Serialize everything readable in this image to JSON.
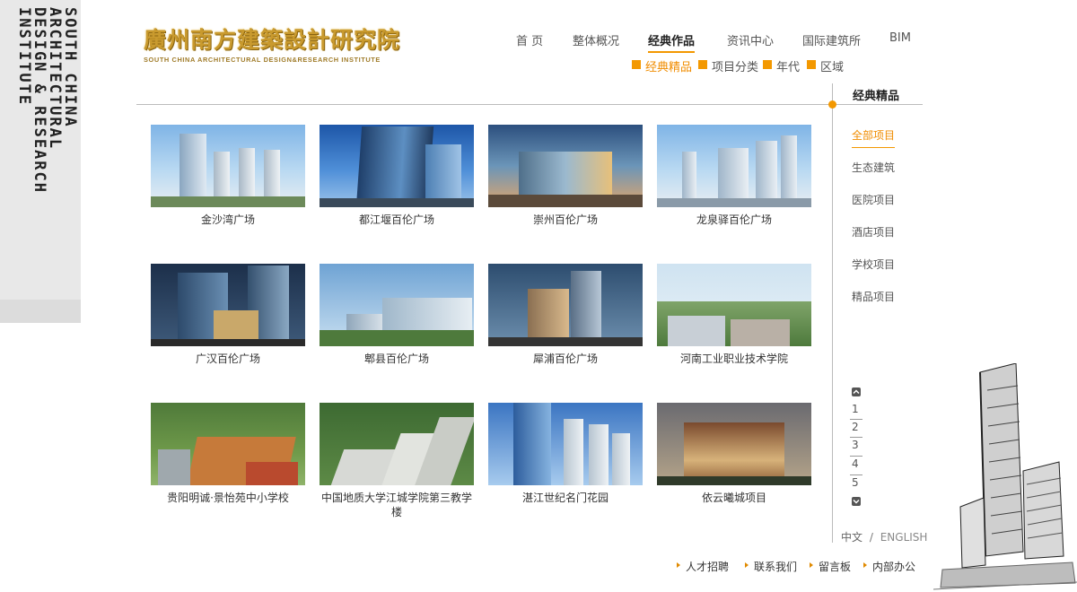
{
  "side_band": {
    "lines": [
      "SOUTH CHINA",
      "ARCHITECTURAL",
      "DESIGN & RESEARCH",
      "INSTITUTE"
    ]
  },
  "logo": {
    "cn": "廣州南方建築設計研究院",
    "en": "SOUTH CHINA ARCHITECTURAL DESIGN&RESEARCH INSTITUTE"
  },
  "nav": {
    "items": [
      "首 页",
      "整体概况",
      "经典作品",
      "资讯中心",
      "国际建筑所",
      "BIM"
    ],
    "active_index": 2
  },
  "subnav": {
    "items": [
      "经典精品",
      "项目分类",
      "年代",
      "区域"
    ],
    "active_index": 0
  },
  "right_panel": {
    "title": "经典精品",
    "categories": [
      "全部项目",
      "生态建筑",
      "医院项目",
      "酒店项目",
      "学校项目",
      "精品项目"
    ],
    "active_index": 0
  },
  "projects": [
    {
      "name": "金沙湾广场"
    },
    {
      "name": "都江堰百伦广场"
    },
    {
      "name": "崇州百伦广场"
    },
    {
      "name": "龙泉驿百伦广场"
    },
    {
      "name": "广汉百伦广场"
    },
    {
      "name": "郫县百伦广场"
    },
    {
      "name": "犀浦百伦广场"
    },
    {
      "name": "河南工业职业技术学院"
    },
    {
      "name": "贵阳明诚·景怡苑中小学校"
    },
    {
      "name": "中国地质大学江城学院第三教学楼"
    },
    {
      "name": "湛江世纪名门花园"
    },
    {
      "name": "依云曦城项目"
    }
  ],
  "pagination": {
    "pages": [
      "1",
      "2",
      "3",
      "4",
      "5"
    ],
    "up_icon": "chevron-up-icon",
    "down_icon": "chevron-down-icon"
  },
  "lang": {
    "cn": "中文",
    "sep": "/",
    "en": "ENGLISH"
  },
  "footer": {
    "links": [
      "人才招聘",
      "联系我们",
      "留言板",
      "内部办公"
    ]
  },
  "colors": {
    "accent": "#f39800",
    "logo_gold": "#c99a2e",
    "band": "#dcdcdc"
  }
}
